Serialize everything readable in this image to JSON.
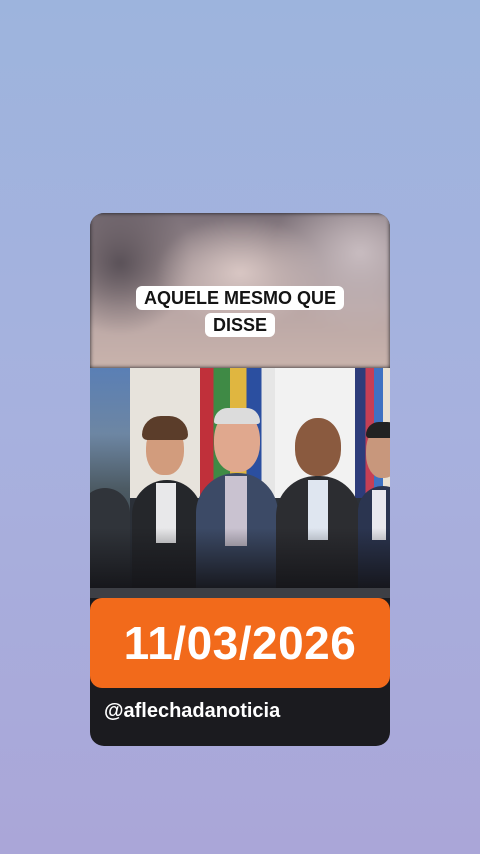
{
  "story": {
    "headline": "AQUELE MESMO QUE DISSE",
    "date": "11/03/2026",
    "handle": "@aflechadanoticia"
  },
  "colors": {
    "background_top": "#9db4dd",
    "background_bottom": "#aaa6d8",
    "date_banner": "#f26a1b",
    "card_bottom": "#1b1b1f"
  }
}
